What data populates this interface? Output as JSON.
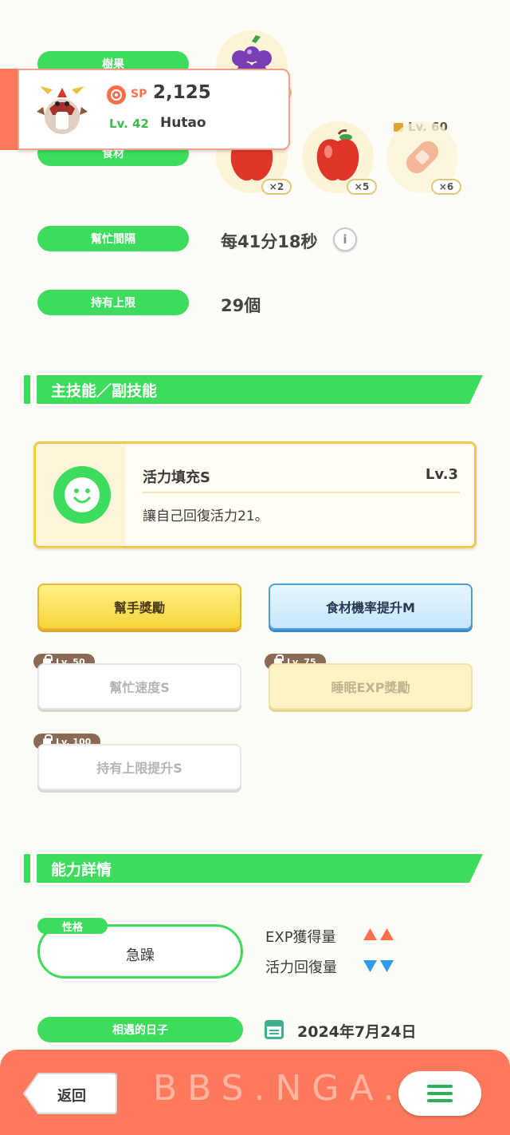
{
  "header": {
    "fruit_label": "樹果",
    "ingredient_label": "食材",
    "ingredient_unlock_level": "Lv. 60",
    "ingredients": [
      {
        "name": "apple",
        "qty": "×2"
      },
      {
        "name": "apple",
        "qty": "×5"
      },
      {
        "name": "sausage",
        "qty": "×6"
      }
    ]
  },
  "profile": {
    "sp_label": "SP",
    "sp_value": "2,125",
    "level": "Lv. 42",
    "name": "Hutao"
  },
  "stats": {
    "help_interval_label": "幫忙間隔",
    "help_interval_value": "每41分18秒",
    "info_icon": "i",
    "capacity_label": "持有上限",
    "capacity_value": "29個"
  },
  "skills_section": {
    "title": "主技能／副技能",
    "main_skill": {
      "name": "活力填充S",
      "level": "Lv.3",
      "description": "讓自己回復活力21。"
    },
    "sub_skills": [
      {
        "label": "幫手獎勵",
        "lock": ""
      },
      {
        "label": "食材機率提升M",
        "lock": ""
      },
      {
        "label": "幫忙速度S",
        "lock": "Lv. 50"
      },
      {
        "label": "睡眠EXP獎勵",
        "lock": "Lv. 75"
      },
      {
        "label": "持有上限提升S",
        "lock": "Lv. 100"
      }
    ]
  },
  "ability_section": {
    "title": "能力詳情",
    "nature_tag": "性格",
    "nature_value": "急躁",
    "exp_label": "EXP獲得量",
    "energy_label": "活力回復量",
    "met_label": "相遇的日子",
    "met_date": "2024年7月24日"
  },
  "bottom_bar": {
    "back_label": "返回",
    "watermark": "BBS.NGA."
  },
  "colors": {
    "green": "#3ddc5c",
    "orange": "#ff7a5c",
    "up_arrow": "#ff6e4a",
    "down_arrow": "#2f9bea"
  }
}
